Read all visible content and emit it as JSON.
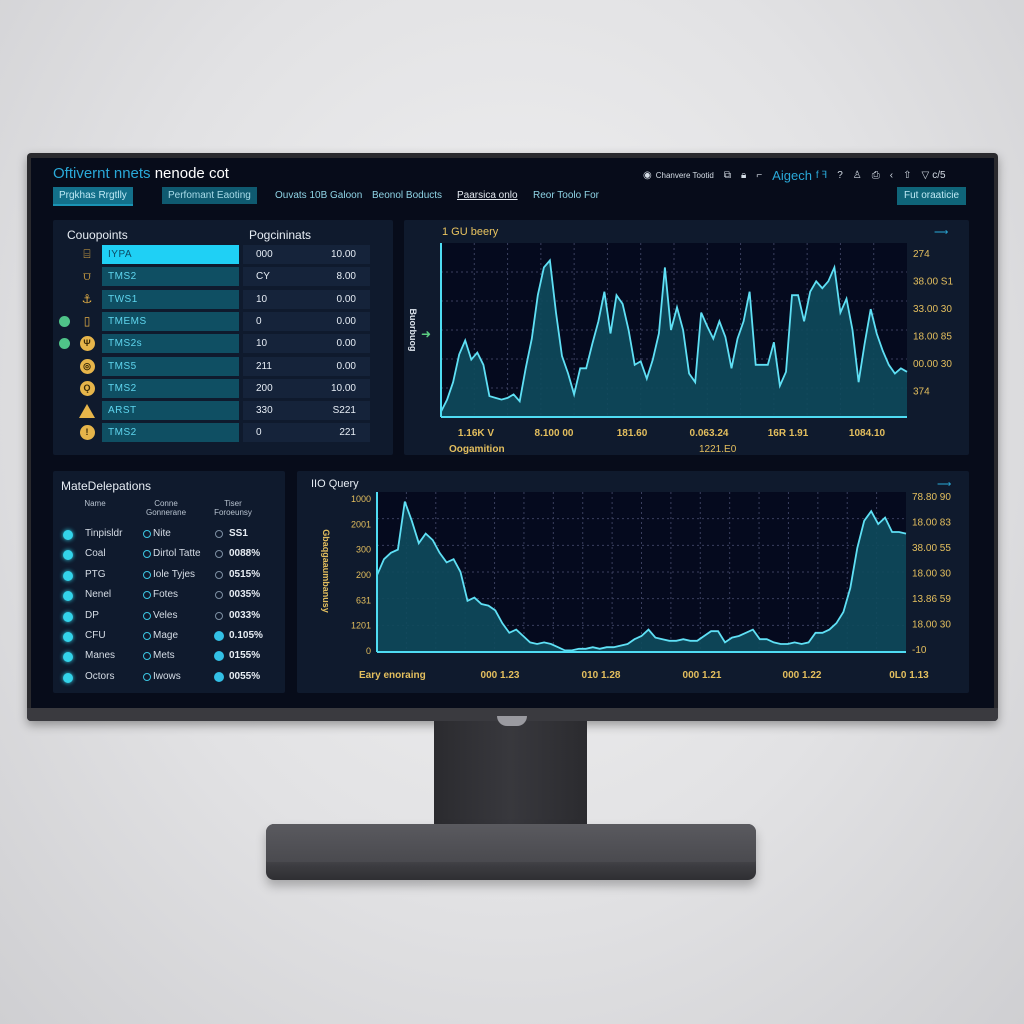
{
  "window": {
    "title_part1": "Oftivernt nnets",
    "title_part2": "nenode cot"
  },
  "nav": {
    "tabs": [
      {
        "label": "Prgkhas Rrgtlly",
        "state": "active"
      },
      {
        "label": "Perfomant Eaoting",
        "state": "box"
      },
      {
        "label": "Ouvats 10B Galoon",
        "state": "plain"
      },
      {
        "label": "Beonol Boducts",
        "state": "plain"
      },
      {
        "label": "Paarsica onlo",
        "state": "underlined"
      },
      {
        "label": "Reor Toolo For",
        "state": "plain"
      }
    ],
    "export_button": "Fut oraaticie"
  },
  "toolbar": {
    "status_label": "Chanvere Tootid",
    "app_name": "Aigech",
    "app_suffix": "f ꟻ",
    "icons": [
      "target-icon",
      "copy-icon",
      "lock-icon",
      "expand-icon",
      "help-icon",
      "user-icon",
      "printer-icon",
      "back-icon",
      "upload-icon",
      "wifi-icon"
    ],
    "trailing_text": "c/5"
  },
  "components_panel": {
    "title_left": "Couopoints",
    "title_right": "Pogcininats",
    "rows": [
      {
        "icon": "archive-icon",
        "name": "IYPA",
        "a": "000",
        "b": "10.00",
        "selected": true,
        "status_dot": false
      },
      {
        "icon": "bucket-icon",
        "name": "TMS2",
        "a": "CY",
        "b": "8.00",
        "selected": false,
        "status_dot": false
      },
      {
        "icon": "anchor-icon",
        "name": "TWS1",
        "a": "10",
        "b": "0.00",
        "selected": false,
        "status_dot": false
      },
      {
        "icon": "document-icon",
        "name": "TMEMS",
        "a": "0",
        "b": "0.00",
        "selected": false,
        "status_dot": true
      },
      {
        "icon": "branch-icon",
        "name": "TMS2s",
        "a": "10",
        "b": "0.00",
        "selected": false,
        "status_dot": true
      },
      {
        "icon": "disk-icon",
        "name": "TMS5",
        "a": "211",
        "b": "0.00",
        "selected": false,
        "status_dot": false
      },
      {
        "icon": "user-circle-icon",
        "name": "TMS2",
        "a": "200",
        "b": "10.00",
        "selected": false,
        "status_dot": false
      },
      {
        "icon": "warning-icon",
        "name": "ARST",
        "a": "330",
        "b": "S221",
        "selected": false,
        "status_dot": false
      },
      {
        "icon": "alert-icon",
        "name": "TMS2",
        "a": "0",
        "b": "221",
        "selected": false,
        "status_dot": false
      }
    ]
  },
  "metadata_panel": {
    "title": "MateDelepations",
    "headers": [
      "Name",
      "Conne Gonnerane",
      "Tiser Foroeunsy"
    ],
    "rows": [
      {
        "name": "Tinpisldr",
        "type": "Nite",
        "value": "SS1",
        "filled": false
      },
      {
        "name": "Coal",
        "type": "Dirtol Tatte",
        "value": "0088%",
        "filled": false
      },
      {
        "name": "PTG",
        "type": "Iole Tyjes",
        "value": "0515%",
        "filled": false
      },
      {
        "name": "Nenel",
        "type": "Fotes",
        "value": "0035%",
        "filled": false
      },
      {
        "name": "DP",
        "type": "Veles",
        "value": "0033%",
        "filled": false
      },
      {
        "name": "CFU",
        "type": "Mage",
        "value": "0.105%",
        "filled": true
      },
      {
        "name": "Manes",
        "type": "Mets",
        "value": "0155%",
        "filled": true
      },
      {
        "name": "Octors",
        "type": "Iwows",
        "value": "0055%",
        "filled": true
      }
    ]
  },
  "chart_data": [
    {
      "type": "area",
      "title": "1 GU beery",
      "xlabel": "Oogamition",
      "xlabel_right": "1221.E0",
      "ylabel": "Buorbuog",
      "x_tick_labels": [
        "1.16K V",
        "8.100 00",
        "181.60",
        "0.063.24",
        "16R 1.91",
        "1084.10"
      ],
      "y_tick_labels_right": [
        "274",
        "38.00 S1",
        "33.00 30",
        "18.00 85",
        "00.00 30",
        "374"
      ],
      "grid": true,
      "legend": "none",
      "ylim": [
        0,
        100
      ],
      "values": [
        3,
        10,
        20,
        36,
        44,
        33,
        37,
        30,
        12,
        11,
        10,
        11,
        13,
        9,
        28,
        45,
        70,
        86,
        90,
        60,
        35,
        25,
        13,
        28,
        28,
        42,
        55,
        72,
        48,
        70,
        65,
        50,
        30,
        32,
        22,
        33,
        48,
        86,
        50,
        63,
        50,
        25,
        20,
        60,
        52,
        45,
        55,
        46,
        28,
        45,
        55,
        72,
        30,
        30,
        30,
        43,
        18,
        26,
        70,
        70,
        55,
        72,
        78,
        74,
        78,
        86,
        60,
        68,
        50,
        20,
        42,
        62,
        48,
        38,
        30,
        25,
        28,
        26
      ]
    },
    {
      "type": "area",
      "title": "IIO Query",
      "xlabel": "Eary enoraing",
      "ylabel": "Gbaqgaaumbanusy",
      "x_tick_labels": [
        "000 1.23",
        "010 1.28",
        "000 1.21",
        "000 1.22",
        "0L0 1.13"
      ],
      "y_tick_labels_left": [
        "1000",
        "2001",
        "300",
        "200",
        "631",
        "1201",
        "0"
      ],
      "y_tick_labels_right": [
        "78.80 90",
        "18.00 83",
        "38.00 55",
        "18.00 30",
        "13.86 59",
        "18.00 30",
        "-10"
      ],
      "grid": true,
      "legend": "none",
      "ylim": [
        0,
        100
      ],
      "values": [
        48,
        58,
        62,
        64,
        94,
        82,
        68,
        74,
        70,
        62,
        56,
        58,
        50,
        32,
        34,
        30,
        29,
        26,
        18,
        12,
        14,
        10,
        6,
        5,
        6,
        5,
        3,
        1,
        1,
        2,
        2,
        3,
        2,
        3,
        3,
        4,
        5,
        8,
        10,
        14,
        9,
        8,
        7,
        7,
        8,
        7,
        7,
        10,
        13,
        13,
        6,
        9,
        10,
        12,
        14,
        8,
        8,
        6,
        5,
        5,
        6,
        5,
        6,
        12,
        12,
        14,
        18,
        25,
        40,
        65,
        82,
        88,
        80,
        84,
        75,
        75,
        74
      ]
    }
  ]
}
